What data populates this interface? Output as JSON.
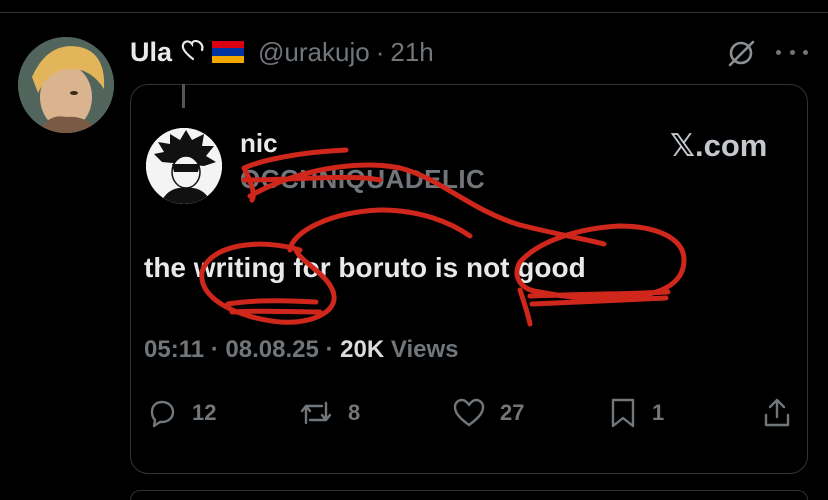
{
  "tweet": {
    "author_name": "Ula",
    "handle": "@urakujo",
    "separator": "·",
    "time": "21h"
  },
  "quoted_card": {
    "name": "nic",
    "handle": "OCCHNIQUADELIC",
    "domain": "X.com",
    "domain_logo": "𝕏",
    "domain_suffix": ".com",
    "text": "the writing for boruto is not good",
    "time": "05:11",
    "date": "08.08.25",
    "views_count": "20K",
    "views_label": "Views",
    "separator": "·"
  },
  "actions": {
    "replies": "12",
    "reposts": "8",
    "likes": "27",
    "bookmarks": "1"
  },
  "colors": {
    "background": "#000000",
    "primary_text": "#e7e9ea",
    "secondary_text": "#71767b",
    "border": "#2f3336",
    "scribble": "#d0271d"
  },
  "icons": [
    "heart-outline-icon",
    "armenia-flag-icon",
    "grok-icon",
    "more-icon",
    "reply-icon",
    "repost-icon",
    "like-icon",
    "bookmark-icon",
    "share-icon"
  ]
}
